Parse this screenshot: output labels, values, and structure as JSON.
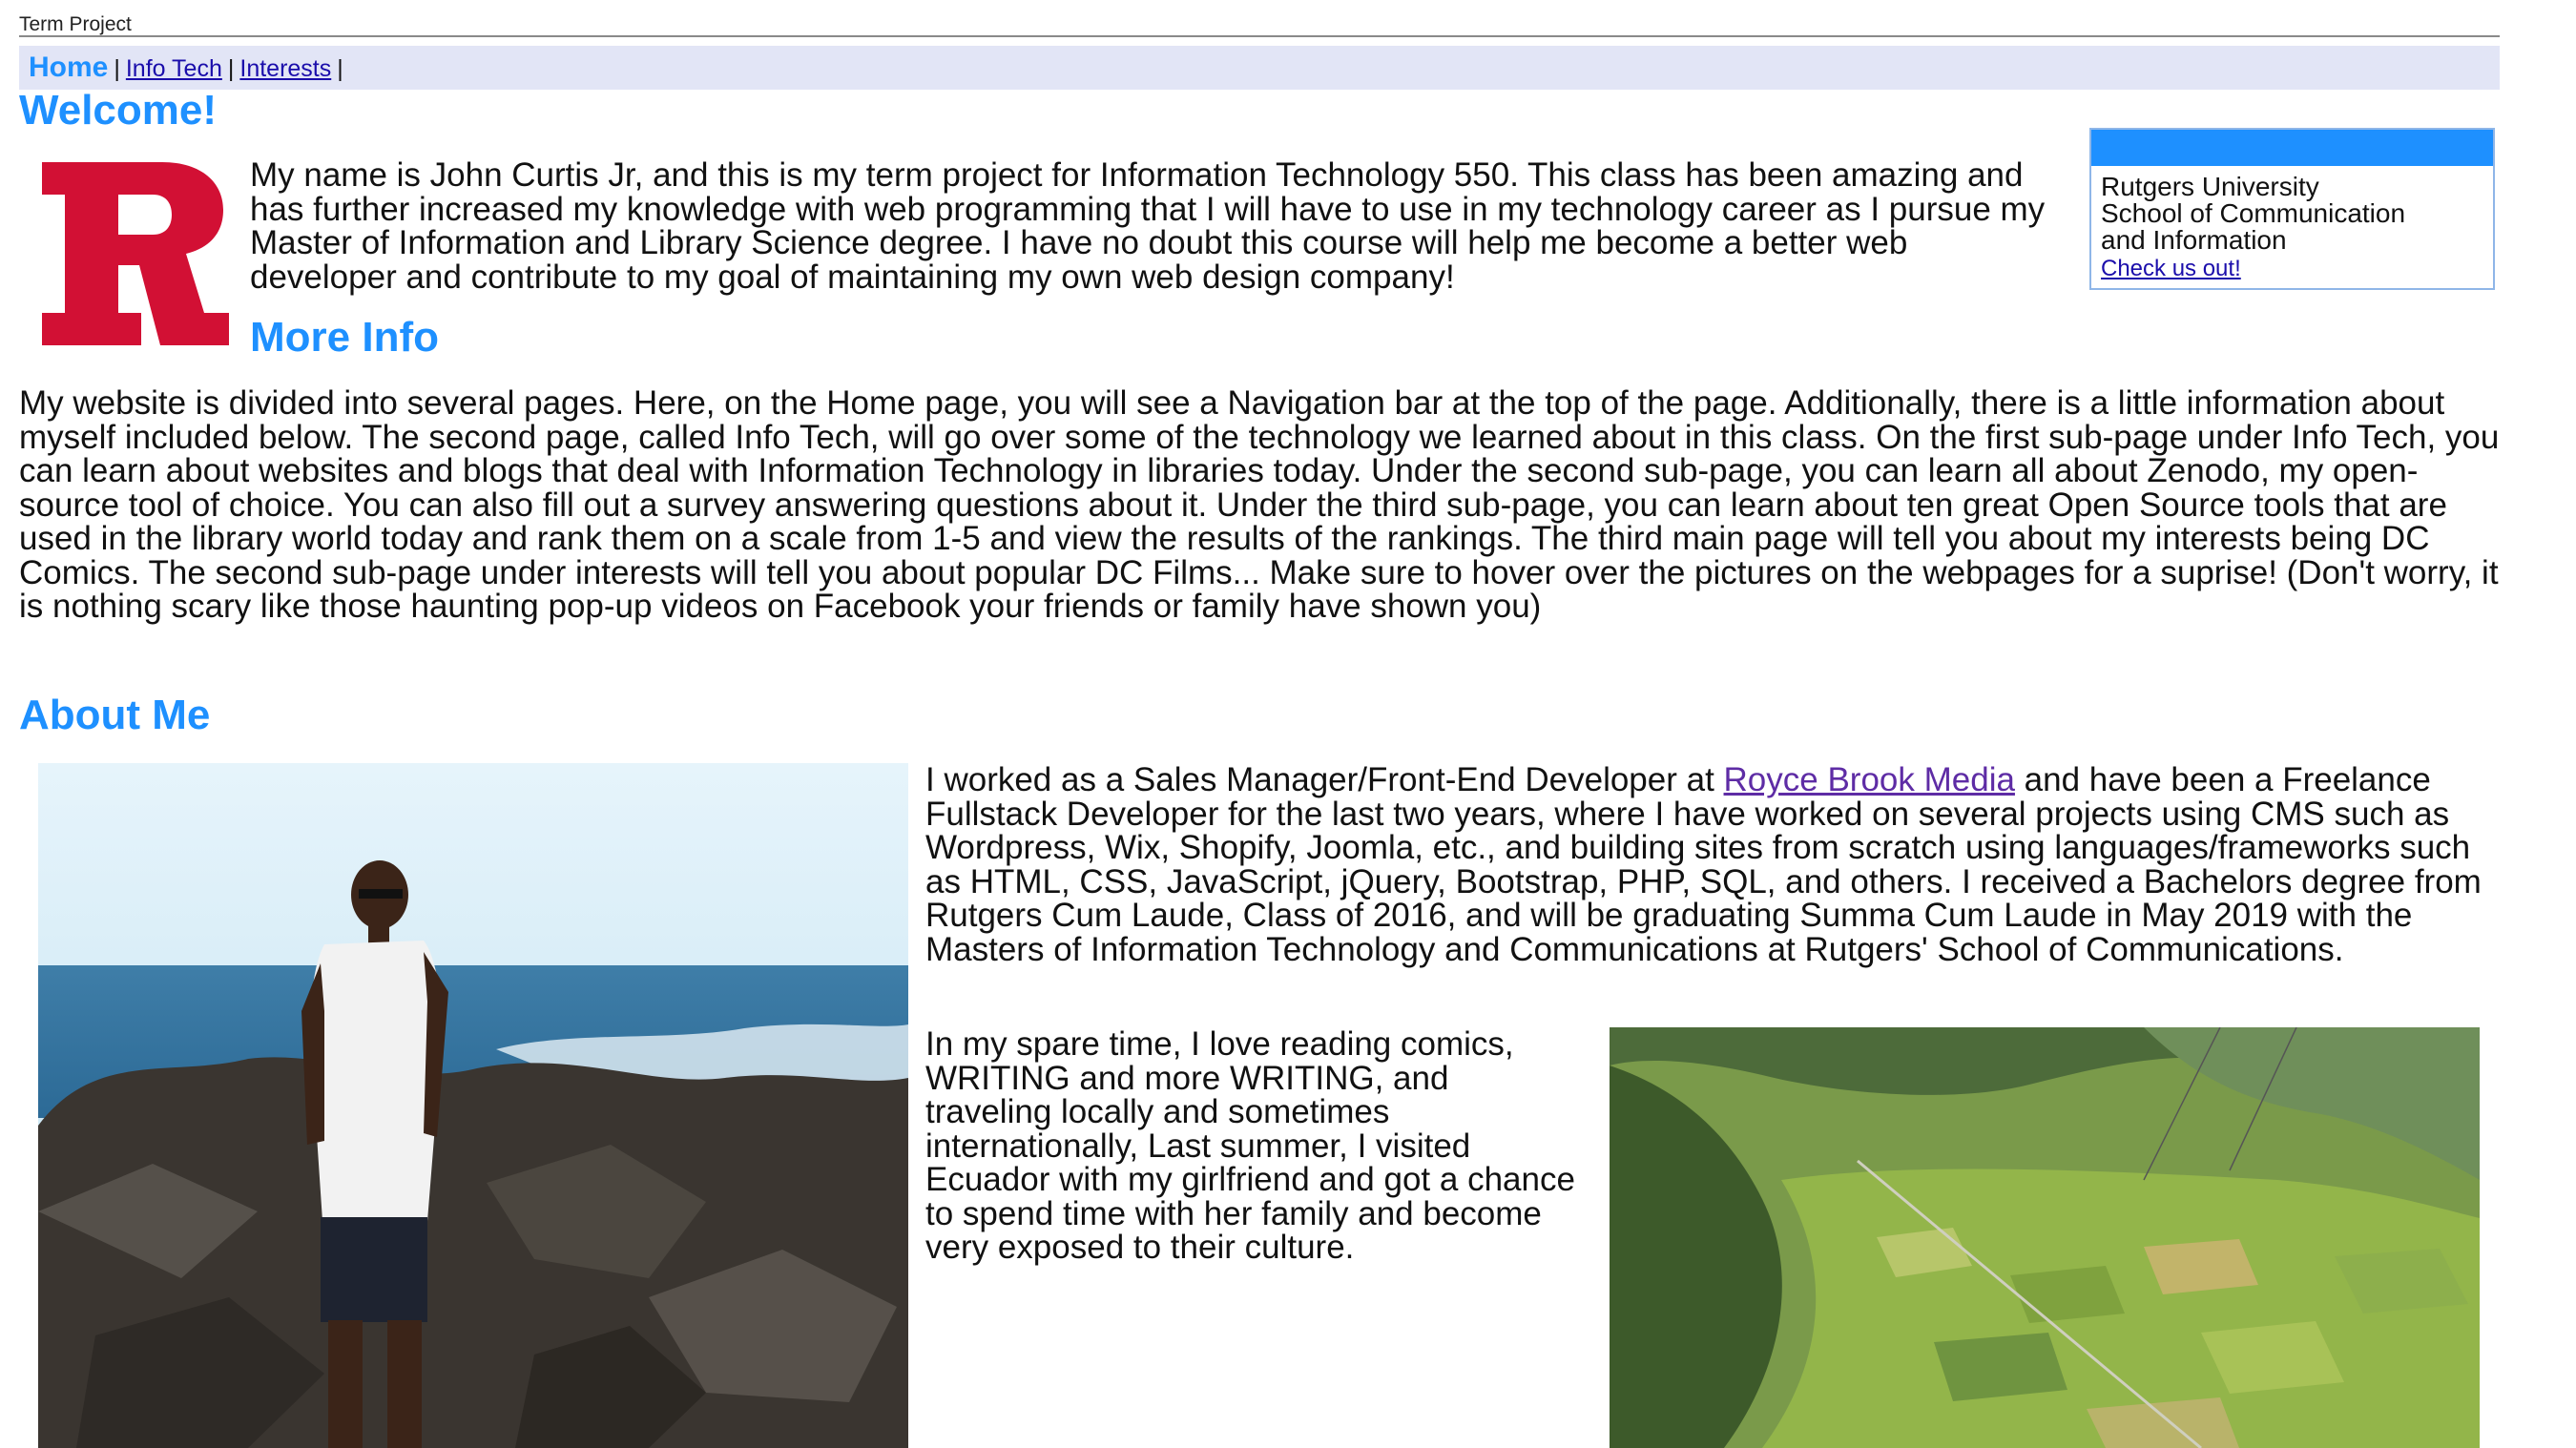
{
  "page": {
    "title": "Term Project"
  },
  "nav": {
    "current": "Home",
    "links": [
      "Info Tech",
      "Interests"
    ],
    "separator": "|"
  },
  "welcome": {
    "heading": "Welcome!",
    "intro": "My name is John Curtis Jr, and this is my term project for Information Technology 550. This class has been amazing and has further increased my knowledge with web programming that I will have to use in my technology career as I pursue my Master of Information and Library Science degree. I have no doubt this course will help me become a better web developer and contribute to my goal of maintaining my own web design company!"
  },
  "sidebox": {
    "line1": "Rutgers University",
    "line2": "School of Communication",
    "line3": "and Information",
    "link": "Check us out!",
    "accent": "#1e90ff"
  },
  "more_info": {
    "heading": "More Info",
    "paragraph": "My website is divided into several pages. Here, on the Home page, you will see a Navigation bar at the top of the page. Additionally, there is a little information about myself included below. The second page, called Info Tech, will go over some of the technology we learned about in this class. On the first sub-page under Info Tech, you can learn about websites and blogs that deal with Information Technology in libraries today. Under the second sub-page, you can learn all about Zenodo, my open-source tool of choice. You can also fill out a survey answering questions about it. Under the third sub-page, you can learn about ten great Open Source tools that are used in the library world today and rank them on a scale from 1-5 and view the results of the rankings. The third main page will tell you about my interests being DC Comics. The second sub-page under interests will tell you about popular DC Films... Make sure to hover over the pictures on the webpages for a suprise! (Don't worry, it is nothing scary like those haunting pop-up videos on Facebook your friends or family have shown you)"
  },
  "about": {
    "heading": "About Me",
    "p1_before": "I worked as a Sales Manager/Front-End Developer at ",
    "p1_link": "Royce Brook Media",
    "p1_after": " and have been a Freelance Fullstack Developer for the last two years, where I have worked on several projects using CMS such as Wordpress, Wix, Shopify, Joomla, etc., and building sites from scratch using languages/frameworks such as HTML, CSS, JavaScript, jQuery, Bootstrap, PHP, SQL, and others. I received a Bachelors degree from Rutgers Cum Laude, Class of 2016, and will be graduating Summa Cum Laude in May 2019 with the Masters of Information Technology and Communications at Rutgers' School of Communications.",
    "p2": "In my spare time, I love reading comics, WRITING and more WRITING, and traveling locally and sometimes internationally, Last summer, I visited Ecuador with my girlfriend and got a chance to spend time with her family and become very exposed to their culture."
  },
  "colors": {
    "heading": "#1e90ff",
    "nav_bg": "#e2e5f6",
    "rutgers_red": "#d21034",
    "link": "#1a0dab",
    "visited_link": "#5e2ca5"
  }
}
